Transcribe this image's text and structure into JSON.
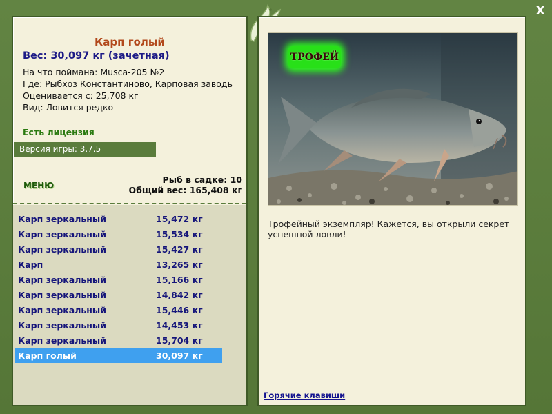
{
  "fish": {
    "name": "Карп голый",
    "weight": "Вес: 30,097 кг (зачетная)",
    "bait": "На что поймана: Musca-205 №2",
    "place": "Где: Рыбхоз Константиново, Карповая заводь",
    "estimated": "Оценивается с: 25,708 кг",
    "kind": "Вид: Ловится редко"
  },
  "license": "Есть лицензия",
  "version": "Версия игры: 3.7.5",
  "menu_label": "МЕНЮ",
  "keepnet": {
    "count": "Рыб в садке: 10",
    "total": "Общий вес: 165,408 кг"
  },
  "catches": [
    {
      "name": "Карп зеркальный",
      "weight": "15,472 кг"
    },
    {
      "name": "Карп зеркальный",
      "weight": "15,534 кг"
    },
    {
      "name": "Карп зеркальный",
      "weight": "15,427 кг"
    },
    {
      "name": "Карп",
      "weight": "13,265 кг"
    },
    {
      "name": "Карп зеркальный",
      "weight": "15,166 кг"
    },
    {
      "name": "Карп зеркальный",
      "weight": "14,842 кг"
    },
    {
      "name": "Карп зеркальный",
      "weight": "15,446 кг"
    },
    {
      "name": "Карп зеркальный",
      "weight": "14,453 кг"
    },
    {
      "name": "Карп зеркальный",
      "weight": "15,704 кг"
    },
    {
      "name": "Карп голый",
      "weight": "30,097 кг"
    }
  ],
  "selected_index": 9,
  "trophy_badge": "ТРОФЕЙ",
  "trophy_message": "Трофейный экземпляр! Кажется, вы открыли секрет успешной ловли!",
  "hotkeys_label": "Горячие клавиши",
  "close_label": "X",
  "colors": {
    "frame": "#56773a",
    "panel": "#f4f1dc",
    "selected_row": "#3fa0ef",
    "fish_name": "#b2491c",
    "list_text": "#15157a"
  }
}
